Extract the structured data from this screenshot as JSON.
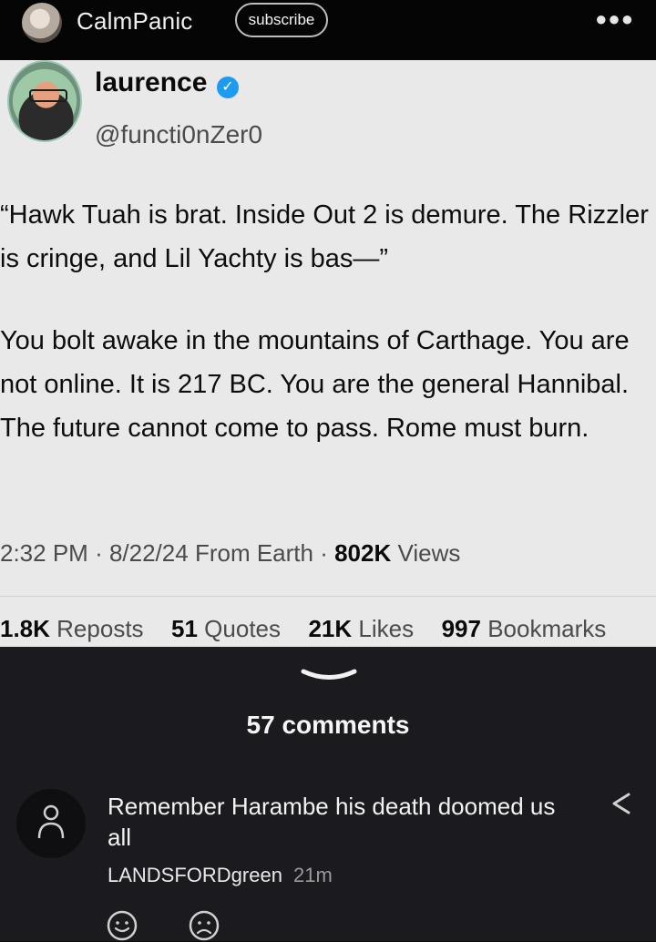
{
  "header": {
    "channel": "CalmPanic",
    "subscribe_label": "subscribe",
    "more_icon": "more-horizontal-icon"
  },
  "tweet": {
    "name": "laurence",
    "handle": "@functi0nZer0",
    "verified_icon": "verified-badge-icon",
    "quote_text": "“Hawk Tuah is brat. Inside Out 2 is demure. The Rizzler is cringe, and Lil Yachty is bas—”",
    "story_text": "You bolt awake in the mountains of Carthage. You are not online. It is 217 BC. You are the general Hannibal. The future cannot come to pass. Rome must burn.",
    "meta": {
      "time": "2:32 PM",
      "date": "8/22/24",
      "source": "From Earth",
      "views_count": "802K",
      "views_label": "Views"
    },
    "stats": [
      {
        "count": "1.8K",
        "label": "Reposts"
      },
      {
        "count": "51",
        "label": "Quotes"
      },
      {
        "count": "21K",
        "label": "Likes"
      },
      {
        "count": "997",
        "label": "Bookmarks"
      }
    ]
  },
  "comments": {
    "count_label": "57 comments",
    "items": [
      {
        "text": "Remember Harambe his death doomed us all",
        "user": "LANDSFORDgreen",
        "time": "21m"
      }
    ],
    "accent": "#f2f2f2"
  }
}
